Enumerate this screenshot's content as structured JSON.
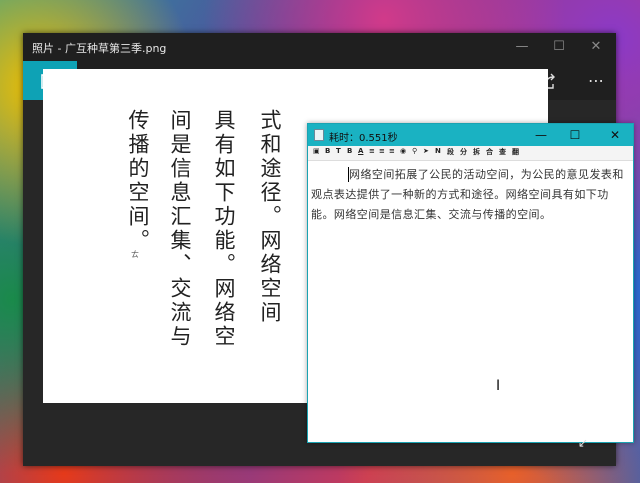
{
  "photos": {
    "title": "照片 - 广互种草第三季.png",
    "toolbar_icons": [
      "image-icon",
      "slideshow-icon",
      "zoom-in-icon",
      "delete-icon",
      "heart-icon",
      "rotate-icon",
      "edit-icon",
      "share-icon",
      "more-icon"
    ],
    "image_columns": [
      "式和途径。网络空间",
      "具有如下功能。网络空",
      "间是信息汇集、交流与",
      "传播的空间。"
    ],
    "tiny_mark": "ㄊ"
  },
  "notepad": {
    "title": "耗时：0.551秒",
    "toolbar_labels": [
      "B",
      "T",
      "B",
      "A",
      "N",
      "段",
      "分",
      "拆",
      "合",
      "查",
      "翻"
    ],
    "text": "网络空间拓展了公民的活动空间，为公民的意见发表和观点表达提供了一种新的方式和途径。网络空间具有如下功能。网络空间是信息汇集、交流与传播的空间。"
  },
  "colors": {
    "accent": "#0ea2b5",
    "notepad_titlebar": "#1ab2c2",
    "dark_bg": "#272727"
  }
}
